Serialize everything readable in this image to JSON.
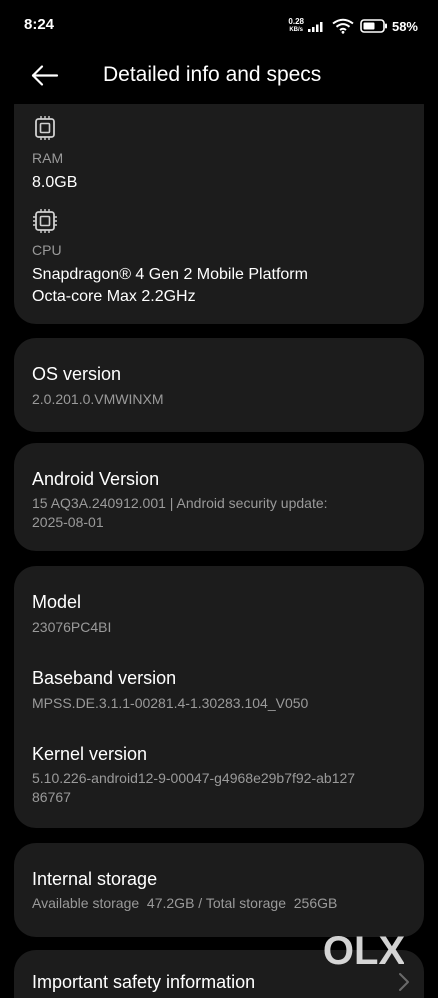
{
  "status_bar": {
    "time": "8:24",
    "net_speed_value": "0.28",
    "net_speed_unit": "KB/s",
    "battery_percent": "58%"
  },
  "header": {
    "title": "Detailed info and specs",
    "back_icon": "arrow-left-icon"
  },
  "specs_card": {
    "ram": {
      "icon": "memory-chip-icon",
      "label": "RAM",
      "value": "8.0GB"
    },
    "cpu": {
      "icon": "cpu-chip-icon",
      "label": "CPU",
      "value_line1": "Snapdragon® 4 Gen 2 Mobile Platform",
      "value_line2": "Octa-core Max 2.2GHz"
    }
  },
  "os_card": {
    "title": "OS version",
    "value": "2.0.201.0.VMWINXM"
  },
  "android_card": {
    "title": "Android Version",
    "value_line1": "15 AQ3A.240912.001 | Android security update:",
    "value_line2": "2025-08-01"
  },
  "device_card": {
    "model_title": "Model",
    "model_value": "23076PC4BI",
    "baseband_title": "Baseband version",
    "baseband_value": "MPSS.DE.3.1.1-00281.4-1.30283.104_V050",
    "kernel_title": "Kernel version",
    "kernel_value_line1": "5.10.226-android12-9-00047-g4968e29b7f92-ab127",
    "kernel_value_line2": "86767"
  },
  "storage_card": {
    "title": "Internal storage",
    "value": "Available storage  47.2GB / Total storage  256GB"
  },
  "safety_card": {
    "title": "Important safety information"
  },
  "watermark": {
    "text": "OLX"
  },
  "colors": {
    "background": "#000000",
    "card": "#1c1c1c",
    "primary_text": "#ffffff",
    "secondary_text": "#9a9a9a"
  }
}
